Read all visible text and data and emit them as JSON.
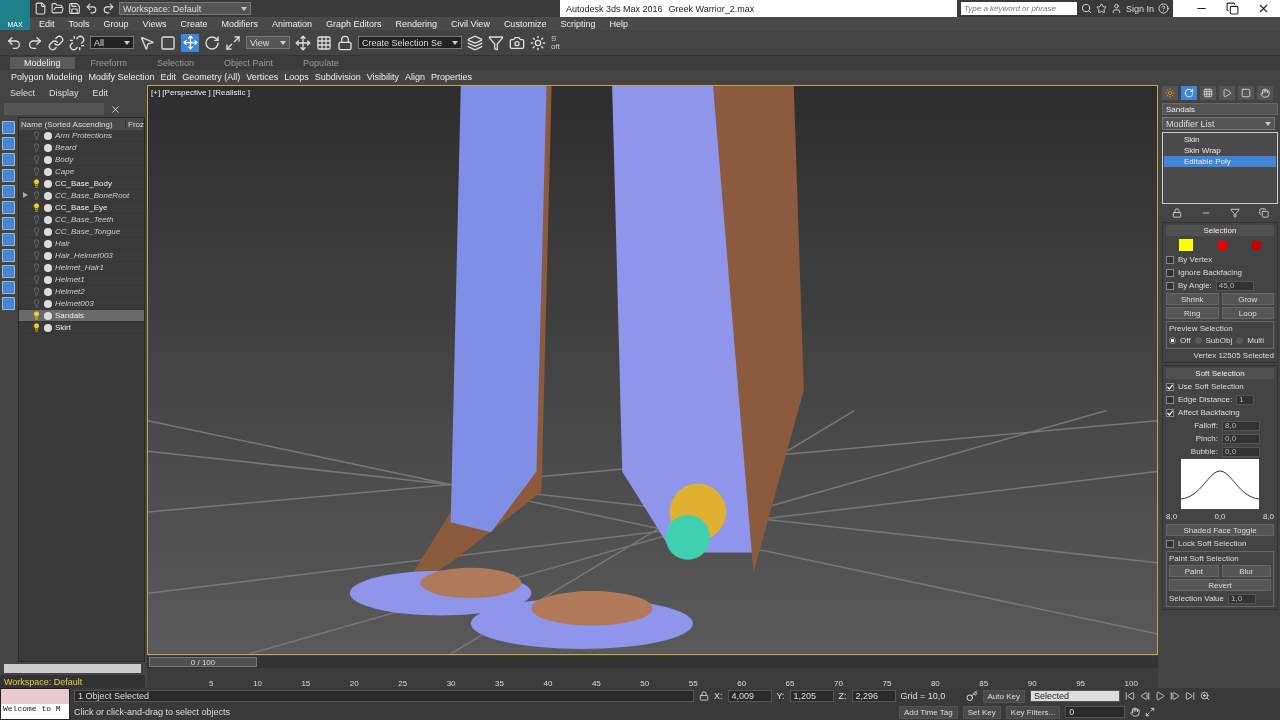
{
  "title_bar": {
    "app_button": "MAX",
    "workspace": "Workspace: Default",
    "title": "Autodesk 3ds Max 2016",
    "file": "Greek Warrior_2.max",
    "search_placeholder": "Type a keyword or phrase",
    "sign_in": "Sign In"
  },
  "menu": [
    "Edit",
    "Tools",
    "Group",
    "Views",
    "Create",
    "Modifiers",
    "Animation",
    "Graph Editors",
    "Rendering",
    "Civil View",
    "Customize",
    "Scripting",
    "Help"
  ],
  "toolbar": {
    "selection_filter": "All",
    "reference_coord": "View",
    "named_selection": "Create Selection Se",
    "side_label": "Soft"
  },
  "ribbon": {
    "tabs": [
      {
        "label": "Modeling",
        "selected": true
      },
      {
        "label": "Freeform",
        "selected": false
      },
      {
        "label": "Selection",
        "selected": false
      },
      {
        "label": "Object Paint",
        "selected": false
      },
      {
        "label": "Populate",
        "selected": false
      }
    ],
    "items": [
      "Polygon Modeling",
      "Modify Selection",
      "Edit",
      "Geometry (All)",
      "Vertices",
      "Loops",
      "Subdivision",
      "Visibility",
      "Align",
      "Properties"
    ]
  },
  "scene_explorer": {
    "menu": [
      "Select",
      "Display",
      "Edit"
    ],
    "columns": [
      "Name (Sorted Ascending)",
      "Froz"
    ],
    "rows": [
      {
        "name": "Arm Protections",
        "visible": false,
        "selected": false
      },
      {
        "name": "Beard",
        "visible": false,
        "selected": false
      },
      {
        "name": "Body",
        "visible": false,
        "selected": false
      },
      {
        "name": "Cape",
        "visible": false,
        "selected": false
      },
      {
        "name": "CC_Base_Body",
        "visible": true,
        "selected": false
      },
      {
        "name": "CC_Base_BoneRoot",
        "visible": false,
        "selected": false,
        "expanded": false
      },
      {
        "name": "CC_Base_Eye",
        "visible": true,
        "selected": false
      },
      {
        "name": "CC_Base_Teeth",
        "visible": false,
        "selected": false
      },
      {
        "name": "CC_Base_Tongue",
        "visible": false,
        "selected": false
      },
      {
        "name": "Hair",
        "visible": false,
        "selected": false
      },
      {
        "name": "Hair_Helmet003",
        "visible": false,
        "selected": false
      },
      {
        "name": "Helmet_Hair1",
        "visible": false,
        "selected": false
      },
      {
        "name": "Helmet1",
        "visible": false,
        "selected": false
      },
      {
        "name": "Helmet2",
        "visible": false,
        "selected": false
      },
      {
        "name": "Helmet003",
        "visible": false,
        "selected": false
      },
      {
        "name": "Sandals",
        "visible": true,
        "selected": true
      },
      {
        "name": "Skirt",
        "visible": true,
        "selected": false
      }
    ],
    "workspace": "Workspace: Default"
  },
  "viewport": {
    "label": "[+] [Perspective ] [Realistic ]",
    "kind": "picture"
  },
  "command_panel": {
    "object_name": "Sandals",
    "modifier_list": "Modifier List",
    "stack": [
      {
        "name": "Skin",
        "selected": false
      },
      {
        "name": "Skin Wrap",
        "selected": false
      },
      {
        "name": "Editable Poly",
        "selected": true
      }
    ],
    "selection": {
      "title": "Selection",
      "by_vertex": {
        "label": "By Vertex",
        "checked": false
      },
      "ignore_backfacing": {
        "label": "Ignore Backfacing",
        "checked": false
      },
      "by_angle": {
        "label": "By Angle:",
        "checked": false,
        "value": "45,0"
      },
      "buttons": [
        "Shrink",
        "Grow",
        "Ring",
        "Loop"
      ],
      "preview_title": "Preview Selection",
      "preview": [
        {
          "label": "Off",
          "selected": true
        },
        {
          "label": "SubObj",
          "selected": false
        },
        {
          "label": "Multi",
          "selected": false
        }
      ],
      "status": "Vertex 12505 Selected"
    },
    "soft_selection": {
      "title": "Soft Selection",
      "use_soft": {
        "label": "Use Soft Selection",
        "checked": true
      },
      "edge_distance": {
        "label": "Edge Distance:",
        "checked": false,
        "value": "1"
      },
      "affect_backfacing": {
        "label": "Affect Backfacing",
        "checked": true
      },
      "fields": [
        {
          "label": "Falloff:",
          "value": "8,0"
        },
        {
          "label": "Pinch:",
          "value": "0,0"
        },
        {
          "label": "Bubble:",
          "value": "0,0"
        }
      ],
      "curve_labels": [
        "8,0",
        "0,0",
        "8,0"
      ],
      "shaded_toggle": "Shaded Face Toggle",
      "lock": {
        "label": "Lock Soft Selection",
        "checked": false
      },
      "paint_title": "Paint Soft Selection",
      "paint": "Paint",
      "blur": "Blur",
      "revert": "Revert",
      "value_label": "Selection Value",
      "value": "1,0"
    }
  },
  "timeline": {
    "slider": "0 / 100",
    "ticks": [
      "5",
      "10",
      "15",
      "20",
      "25",
      "30",
      "35",
      "40",
      "45",
      "50",
      "55",
      "60",
      "65",
      "70",
      "75",
      "80",
      "85",
      "90",
      "95",
      "100"
    ]
  },
  "status_bar": {
    "listener": "Welcome to M",
    "selected_count": "1 Object Selected",
    "prompt": "Click or click-and-drag to select objects",
    "coords": [
      {
        "label": "X:",
        "value": "4,009"
      },
      {
        "label": "Y:",
        "value": "1,205"
      },
      {
        "label": "Z:",
        "value": "2,296"
      }
    ],
    "grid": "Grid = 10,0",
    "time_tag": "Add Time Tag",
    "auto_key": "Auto Key",
    "key_mode": "Selected",
    "set_key": "Set Key",
    "key_filters": "Key Filters...",
    "frame": "0"
  }
}
